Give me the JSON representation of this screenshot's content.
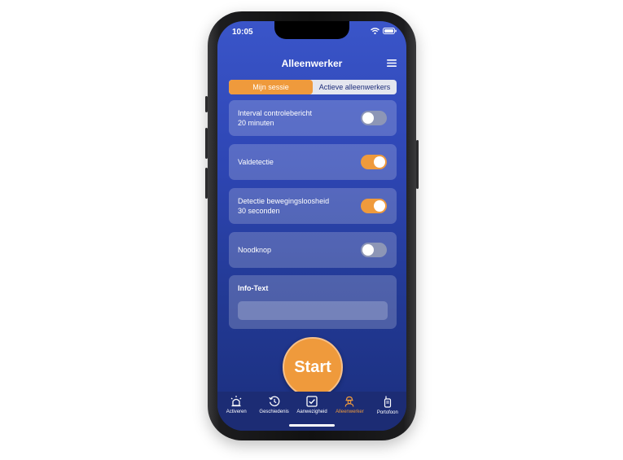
{
  "status": {
    "time": "10:05"
  },
  "header": {
    "title": "Alleenwerker"
  },
  "segments": [
    {
      "label": "Mijn sessie",
      "active": true
    },
    {
      "label": "Actieve alleenwerkers",
      "active": false
    }
  ],
  "settings": [
    {
      "label": "Interval controlebericht",
      "sub": "20 minuten",
      "on": false
    },
    {
      "label": "Valdetectie",
      "sub": "",
      "on": true
    },
    {
      "label": "Detectie bewegingsloosheid",
      "sub": "30 seconden",
      "on": true
    },
    {
      "label": "Noodknop",
      "sub": "",
      "on": false
    }
  ],
  "info": {
    "title": "Info-Text",
    "value": ""
  },
  "start_label": "Start",
  "tabs": [
    {
      "label": "Activeren",
      "icon": "alarm-light-icon",
      "active": false
    },
    {
      "label": "Geschiedenis",
      "icon": "history-icon",
      "active": false
    },
    {
      "label": "Aanwezigheid",
      "icon": "checkbox-icon",
      "active": false
    },
    {
      "label": "Alleenwerker",
      "icon": "worker-icon",
      "active": true
    },
    {
      "label": "Portofoon",
      "icon": "walkie-talkie-icon",
      "active": false
    }
  ],
  "colors": {
    "accent": "#ef9a3c",
    "background": "#2e46b4",
    "tabbar": "#1c2c74"
  }
}
